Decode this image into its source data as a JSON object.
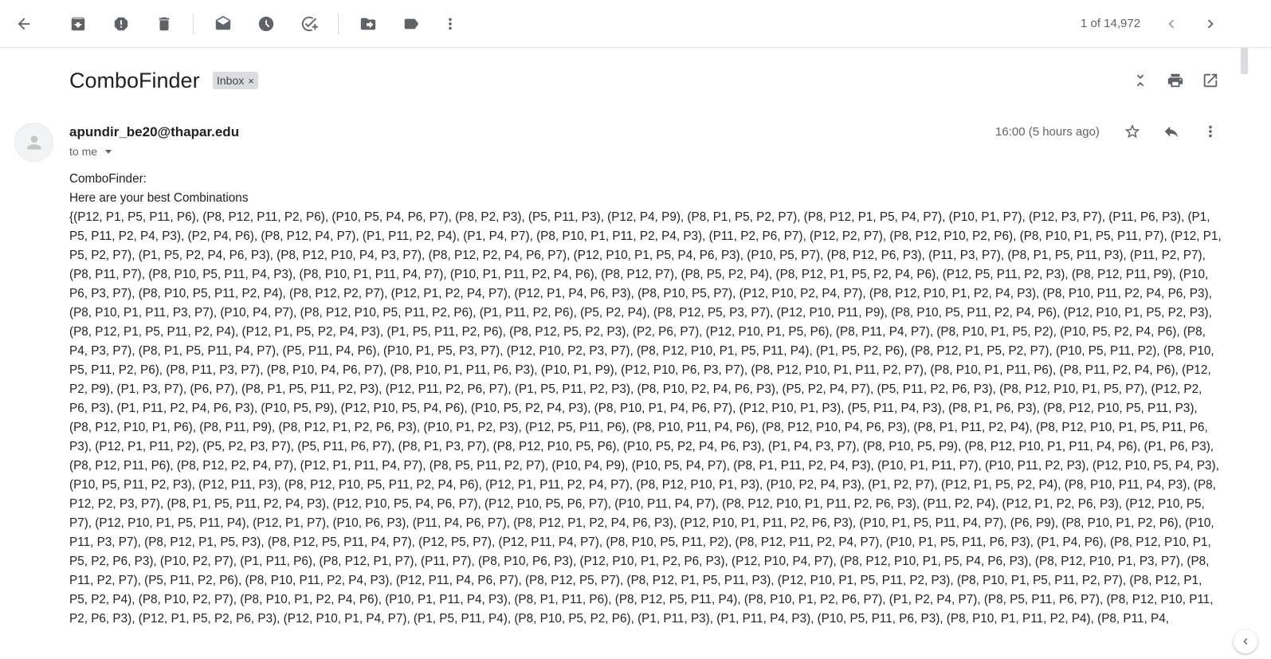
{
  "toolbar": {
    "icons": [
      "back-arrow-icon",
      "archive-icon",
      "report-spam-icon",
      "delete-icon",
      "mark-unread-icon",
      "snooze-icon",
      "add-task-icon",
      "move-to-icon",
      "label-icon",
      "more-vert-icon"
    ],
    "pagination": "1 of 14,972"
  },
  "email": {
    "subject": "ComboFinder",
    "label": "Inbox",
    "label_close": "×",
    "sender": "apundir_be20@thapar.edu",
    "recipient": "to me",
    "time": "16:00 (5 hours ago)",
    "body_line1": "ComboFinder:",
    "body_line2": "Here are your best Combinations",
    "body_combos": "{(P12, P1, P5, P11, P6), (P8, P12, P11, P2, P6), (P10, P5, P4, P6, P7), (P8, P2, P3), (P5, P11, P3), (P12, P4, P9), (P8, P1, P5, P2, P7), (P8, P12, P1, P5, P4, P7), (P10, P1, P7), (P12, P3, P7), (P11, P6, P3), (P1, P5, P11, P2, P4, P3), (P2, P4, P6), (P8, P12, P4, P7), (P1, P11, P2, P4), (P1, P4, P7), (P8, P10, P1, P11, P2, P4, P3), (P11, P2, P6, P7), (P12, P2, P7), (P8, P12, P10, P2, P6), (P8, P10, P1, P5, P11, P7), (P12, P1, P5, P2, P7), (P1, P5, P2, P4, P6, P3), (P8, P12, P10, P4, P3, P7), (P8, P12, P2, P4, P6, P7), (P12, P10, P1, P5, P4, P6, P3), (P10, P5, P7), (P8, P12, P6, P3), (P11, P3, P7), (P8, P1, P5, P11, P3), (P11, P2, P7), (P8, P11, P7), (P8, P10, P5, P11, P4, P3), (P8, P10, P1, P11, P4, P7), (P10, P1, P11, P2, P4, P6), (P8, P12, P7), (P8, P5, P2, P4), (P8, P12, P1, P5, P2, P4, P6), (P12, P5, P11, P2, P3), (P8, P12, P11, P9), (P10, P6, P3, P7), (P8, P10, P5, P11, P2, P4), (P8, P12, P2, P7), (P12, P1, P2, P4, P7), (P12, P1, P4, P6, P3), (P8, P10, P5, P7), (P12, P10, P2, P4, P7), (P8, P12, P10, P1, P2, P4, P3), (P8, P10, P11, P2, P4, P6, P3), (P8, P10, P1, P11, P3, P7), (P10, P4, P7), (P8, P12, P10, P5, P11, P2, P6), (P1, P11, P2, P6), (P5, P2, P4), (P8, P12, P5, P3, P7), (P12, P10, P11, P9), (P8, P10, P5, P11, P2, P4, P6), (P12, P10, P1, P5, P2, P3), (P8, P12, P1, P5, P11, P2, P4), (P12, P1, P5, P2, P4, P3), (P1, P5, P11, P2, P6), (P8, P12, P5, P2, P3), (P2, P6, P7), (P12, P10, P1, P5, P6), (P8, P11, P4, P7), (P8, P10, P1, P5, P2), (P10, P5, P2, P4, P6), (P8, P4, P3, P7), (P8, P1, P5, P11, P4, P7), (P5, P11, P4, P6), (P10, P1, P5, P3, P7), (P12, P10, P2, P3, P7), (P8, P12, P10, P1, P5, P11, P4), (P1, P5, P2, P6), (P8, P12, P1, P5, P2, P7), (P10, P5, P11, P2), (P8, P10, P5, P11, P2, P6), (P8, P11, P3, P7), (P8, P10, P4, P6, P7), (P8, P10, P1, P11, P6, P3), (P10, P1, P9), (P12, P10, P6, P3, P7), (P8, P12, P10, P1, P11, P2, P7), (P8, P10, P1, P11, P6), (P8, P11, P2, P4, P6), (P12, P2, P9), (P1, P3, P7), (P6, P7), (P8, P1, P5, P11, P2, P3), (P12, P11, P2, P6, P7), (P1, P5, P11, P2, P3), (P8, P10, P2, P4, P6, P3), (P5, P2, P4, P7), (P5, P11, P2, P6, P3), (P8, P12, P10, P1, P5, P7), (P12, P2, P6, P3), (P1, P11, P2, P4, P6, P3), (P10, P5, P9), (P12, P10, P5, P4, P6), (P10, P5, P2, P4, P3), (P8, P10, P1, P4, P6, P7), (P12, P10, P1, P3), (P5, P11, P4, P3), (P8, P1, P6, P3), (P8, P12, P10, P5, P11, P3), (P8, P12, P10, P1, P6), (P8, P11, P9), (P8, P12, P1, P2, P6, P3), (P10, P1, P2, P3), (P12, P5, P11, P6), (P8, P10, P11, P4, P6), (P8, P12, P10, P4, P6, P3), (P8, P1, P11, P2, P4), (P8, P12, P10, P1, P5, P11, P6, P3), (P12, P1, P11, P2), (P5, P2, P3, P7), (P5, P11, P6, P7), (P8, P1, P3, P7), (P8, P12, P10, P5, P6), (P10, P5, P2, P4, P6, P3), (P1, P4, P3, P7), (P8, P10, P5, P9), (P8, P12, P10, P1, P11, P4, P6), (P1, P6, P3), (P8, P12, P11, P6), (P8, P12, P2, P4, P7), (P12, P1, P11, P4, P7), (P8, P5, P11, P2, P7), (P10, P4, P9), (P10, P5, P4, P7), (P8, P1, P11, P2, P4, P3), (P10, P1, P11, P7), (P10, P11, P2, P3), (P12, P10, P5, P4, P3), (P10, P5, P11, P2, P3), (P12, P11, P3), (P8, P12, P10, P5, P11, P2, P4, P6), (P12, P1, P11, P2, P4, P7), (P8, P12, P10, P1, P3), (P10, P2, P4, P3), (P1, P2, P7), (P12, P1, P5, P2, P4), (P8, P10, P11, P4, P3), (P8, P12, P2, P3, P7), (P8, P1, P5, P11, P2, P4, P3), (P12, P10, P5, P4, P6, P7), (P12, P10, P5, P6, P7), (P10, P11, P4, P7), (P8, P12, P10, P1, P11, P2, P6, P3), (P11, P2, P4), (P12, P1, P2, P6, P3), (P12, P10, P5, P7), (P12, P10, P1, P5, P11, P4), (P12, P1, P7), (P10, P6, P3), (P11, P4, P6, P7), (P8, P12, P1, P2, P4, P6, P3), (P12, P10, P1, P11, P2, P6, P3), (P10, P1, P5, P11, P4, P7), (P6, P9), (P8, P10, P1, P2, P6), (P10, P11, P3, P7), (P8, P12, P1, P5, P3), (P8, P12, P5, P11, P4, P7), (P12, P5, P7), (P12, P11, P4, P7), (P8, P10, P5, P11, P2), (P8, P12, P11, P2, P4, P7), (P10, P1, P5, P11, P6, P3), (P1, P4, P6), (P8, P12, P10, P1, P5, P2, P6, P3), (P10, P2, P7), (P1, P11, P6), (P8, P12, P1, P7), (P11, P7), (P8, P10, P6, P3), (P12, P10, P1, P2, P6, P3), (P12, P10, P4, P7), (P8, P12, P10, P1, P5, P4, P6, P3), (P8, P12, P10, P1, P3, P7), (P8, P11, P2, P7), (P5, P11, P2, P6), (P8, P10, P11, P2, P4, P3), (P12, P11, P4, P6, P7), (P8, P12, P5, P7), (P8, P12, P1, P5, P11, P3), (P12, P10, P1, P5, P11, P2, P3), (P8, P10, P1, P5, P11, P2, P7), (P8, P12, P1, P5, P2, P4), (P8, P10, P2, P7), (P8, P10, P1, P2, P4, P6), (P10, P1, P11, P4, P3), (P8, P1, P11, P6), (P8, P12, P5, P11, P4), (P8, P10, P1, P2, P6, P7), (P1, P2, P4, P7), (P8, P5, P11, P6, P7), (P8, P12, P10, P11, P2, P6, P3), (P12, P1, P5, P2, P6, P3), (P12, P10, P1, P4, P7), (P1, P5, P11, P4), (P8, P10, P5, P2, P6), (P1, P11, P3), (P1, P11, P4, P3), (P10, P5, P11, P6, P3), (P8, P10, P1, P11, P2, P4), (P8, P11, P4,"
  }
}
